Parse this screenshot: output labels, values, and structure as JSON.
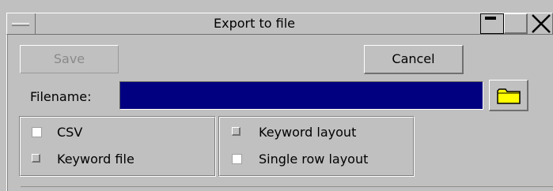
{
  "window": {
    "title": "Export to file"
  },
  "toolbar": {
    "save_label": "Save",
    "cancel_label": "Cancel",
    "save_enabled": false
  },
  "filename": {
    "label": "Filename:",
    "value": "",
    "field_color": "#000080"
  },
  "formats": {
    "csv": {
      "label": "CSV",
      "checked": false
    },
    "keyword_file": {
      "label": "Keyword file",
      "checked": false
    }
  },
  "layouts": {
    "keyword_layout": {
      "label": "Keyword layout",
      "checked": false
    },
    "single_row_layout": {
      "label": "Single row layout",
      "checked": false
    }
  },
  "icons": {
    "folder": "folder-icon",
    "minimize": "minimize-icon",
    "maximize": "maximize-icon",
    "close": "close-icon",
    "window_menu": "window-menu-icon"
  },
  "colors": {
    "folder_fill": "#ffff00",
    "background": "#c0c0c0"
  }
}
